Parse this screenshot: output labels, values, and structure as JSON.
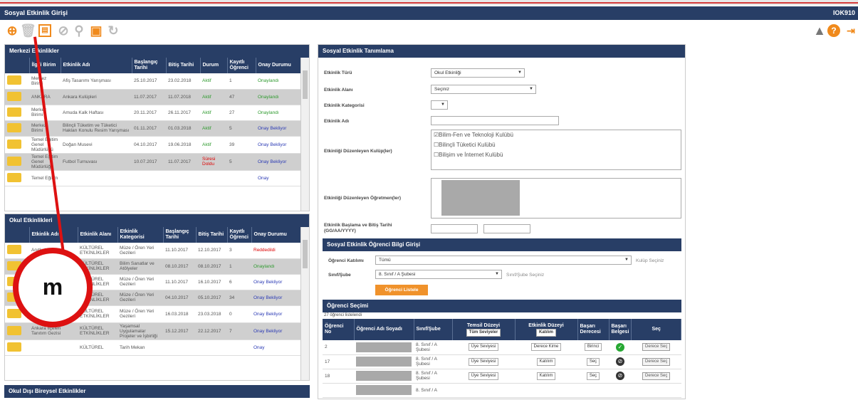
{
  "app": {
    "title": "Sosyal Etkinlik Girişi",
    "right_label": "IOK910"
  },
  "toolbar_icons": [
    "add-icon",
    "delete-icon",
    "save-icon",
    "cancel-icon",
    "search-icon",
    "print-icon",
    "refresh-icon"
  ],
  "help_icons": [
    "warning-icon",
    "help-icon",
    "exit-icon"
  ],
  "merkezi": {
    "title": "Merkezi Etkinlikler",
    "columns": [
      "İlgili Birim",
      "Etkinlik Adı",
      "Başlangıç Tarihi",
      "Bitiş Tarihi",
      "Durum",
      "Kayıtlı Öğrenci",
      "Onay Durumu"
    ],
    "rows": [
      {
        "birim": "Merkez Birimi",
        "ad": "Afiş Tasarımı Yarışması",
        "bas": "25.10.2017",
        "bit": "23.02.2018",
        "durum": "Aktif",
        "kayit": "1",
        "onay": "Onaylandı",
        "onay_color": "green"
      },
      {
        "birim": "ANKARA",
        "ad": "Ankara Kulüpleri",
        "bas": "11.07.2017",
        "bit": "11.07.2018",
        "durum": "Aktif",
        "kayit": "47",
        "onay": "Onaylandı",
        "onay_color": "green"
      },
      {
        "birim": "Merkez Birimi",
        "ad": "Amuda Kalk Haftası",
        "bas": "20.11.2017",
        "bit": "26.11.2017",
        "durum": "Aktif",
        "kayit": "27",
        "onay": "Onaylandı",
        "onay_color": "green"
      },
      {
        "birim": "Merkez Birimi",
        "ad": "Bilinçli Tüketim ve Tüketici Hakları Konulu Resim Yarışması",
        "bas": "01.11.2017",
        "bit": "01.03.2018",
        "durum": "Aktif",
        "kayit": "5",
        "onay": "Onay Bekliyor",
        "onay_color": "blue"
      },
      {
        "birim": "Temel Eğitim Genel Müdürlüğü",
        "ad": "Doğan Musevi",
        "bas": "04.10.2017",
        "bit": "19.06.2018",
        "durum": "Aktif",
        "kayit": "39",
        "onay": "Onay Bekliyor",
        "onay_color": "blue"
      },
      {
        "birim": "Temel Eğitim Genel Müdürlüğü",
        "ad": "Futbol Turnuvası",
        "bas": "10.07.2017",
        "bit": "11.07.2017",
        "durum": "Süresi Doldu",
        "kayit": "5",
        "onay": "Onay Bekliyor",
        "onay_color": "blue"
      },
      {
        "birim": "Temel Eğitim",
        "ad": "",
        "bas": "",
        "bit": "",
        "durum": "",
        "kayit": "",
        "onay": "Onay",
        "onay_color": "blue"
      }
    ]
  },
  "okul": {
    "title": "Okul Etkinlikleri",
    "columns": [
      "Etkinlik Adı",
      "Etkinlik Alanı",
      "Etkinlik Kategorisi",
      "Başlangıç Tarihi",
      "Bitiş Tarihi",
      "Kayıtlı Öğrenci",
      "Onay Durumu"
    ],
    "rows": [
      {
        "ad": "Anıtkabir",
        "alan": "KÜLTÜREL ETKİNLİKLER",
        "kat": "Müze / Ören Yeri Gezileri",
        "bas": "11.10.2017",
        "bit": "12.10.2017",
        "kayit": "3",
        "onay": "Reddedildi",
        "onay_color": "red"
      },
      {
        "ad": "",
        "alan": "KÜLTÜREL ETKİNLİKLER",
        "kat": "Bilim Sanatlar ve Atölyeler",
        "bas": "08.10.2017",
        "bit": "08.10.2017",
        "kayit": "1",
        "onay": "Onaylandı",
        "onay_color": "green"
      },
      {
        "ad": "",
        "alan": "KÜLTÜREL ETKİNLİKLER",
        "kat": "Müze / Ören Yeri Gezileri",
        "bas": "11.10.2017",
        "bit": "16.10.2017",
        "kayit": "6",
        "onay": "Onay Bekliyor",
        "onay_color": "blue"
      },
      {
        "ad": "",
        "alan": "KÜLTÜREL ETKİNLİKLER",
        "kat": "Müze / Ören Yeri Gezileri",
        "bas": "04.10.2017",
        "bit": "05.10.2017",
        "kayit": "34",
        "onay": "Onay Bekliyor",
        "onay_color": "blue"
      },
      {
        "ad": "Ankara Resim ve Heykel Müzesi Gezisi",
        "alan": "KÜLTÜREL ETKİNLİKLER",
        "kat": "Müze / Ören Yeri Gezileri",
        "bas": "16.03.2018",
        "bit": "23.03.2018",
        "kayit": "0",
        "onay": "Onay Bekliyor",
        "onay_color": "blue"
      },
      {
        "ad": "Ankara İlçeleri Tanıtım Gezisi",
        "alan": "KÜLTÜREL ETKİNLİKLER",
        "kat": "Yaşamsal Uygulamalar Projeler ve İşbirliği",
        "bas": "15.12.2017",
        "bit": "22.12.2017",
        "kayit": "7",
        "onay": "Onay Bekliyor",
        "onay_color": "blue"
      },
      {
        "ad": "",
        "alan": "KÜLTÜREL",
        "kat": "Tarih Mekan",
        "bas": "",
        "bit": "",
        "kayit": "",
        "onay": "Onay",
        "onay_color": "blue"
      }
    ]
  },
  "okul_disi": {
    "title": "Okul Dışı Bireysel Etkinlikler"
  },
  "tanim": {
    "title": "Sosyal Etkinlik Tanımlama",
    "tur_label": "Etkinlik Türü",
    "tur_value": "Okul Etkinliği",
    "alan_label": "Etkinlik Alanı",
    "alan_value": "Seçiniz",
    "kategori_label": "Etkinlik Kategorisi",
    "ad_label": "Etkinlik Adı",
    "kulup_label": "Etkinliği Düzenleyen Kulüp(ler)",
    "kulupler": [
      "Bilim-Fen ve Teknoloji Kulübü",
      "Bilinçli Tüketici Kulübü",
      "Bilişim ve İnternet Kulübü"
    ],
    "ogretmen_label": "Etkinliği Düzenleyen Öğretmen(ler)",
    "tarih_label": "Etkinlik Başlama ve Bitiş Tarihi (GG/AA/YYYY)"
  },
  "ogrenci_giris": {
    "title": "Sosyal Etkinlik Öğrenci Bilgi Girişi",
    "katilim_label": "Öğrenci Katılımı",
    "katilim_value": "Tümü",
    "katilim_hint": "Kulüp Seçiniz",
    "sube_label": "Sınıf/Şube",
    "sube_value": "8. Sınıf / A Şubesi",
    "sube_hint": "Sınıf/Şube Seçiniz",
    "listele_button": "Öğrenci Listele"
  },
  "secimi": {
    "title": "Öğrenci Seçimi",
    "count_text": "27 öğrenci listelendi",
    "columns": [
      "Öğrenci No",
      "Öğrenci Adı Soyadı",
      "Sınıf/Şube",
      "Temsil Düzeyi",
      "Etkinlik Düzeyi",
      "Başarı Derecesi",
      "Başarı Belgesi",
      "Seç"
    ],
    "header_temsil": "Tüm Seviyeler",
    "header_etkinlik": "Katılım",
    "rows": [
      {
        "no": "2",
        "sube": "8. Sınıf / A Şubesi",
        "temsil": "Üye Seviyesi",
        "etkinlik": "Derece Kime",
        "derece": "Birinci",
        "belge": "ok",
        "sec": "Derece Seç"
      },
      {
        "no": "17",
        "sube": "8. Sınıf / A Şubesi",
        "temsil": "Üye Seviyesi",
        "etkinlik": "Katılım",
        "derece": "Seç",
        "belge": "no",
        "sec": "Derece Seç"
      },
      {
        "no": "18",
        "sube": "8. Sınıf / A Şubesi",
        "temsil": "Üye Seviyesi",
        "etkinlik": "Katılım",
        "derece": "Seç",
        "belge": "no",
        "sec": "Derece Seç"
      },
      {
        "no": "",
        "sube": "8. Sınıf / A",
        "temsil": "",
        "etkinlik": "",
        "derece": "",
        "belge": "",
        "sec": ""
      }
    ]
  },
  "annotation": {
    "letter": "m",
    "color": "#d11111"
  }
}
